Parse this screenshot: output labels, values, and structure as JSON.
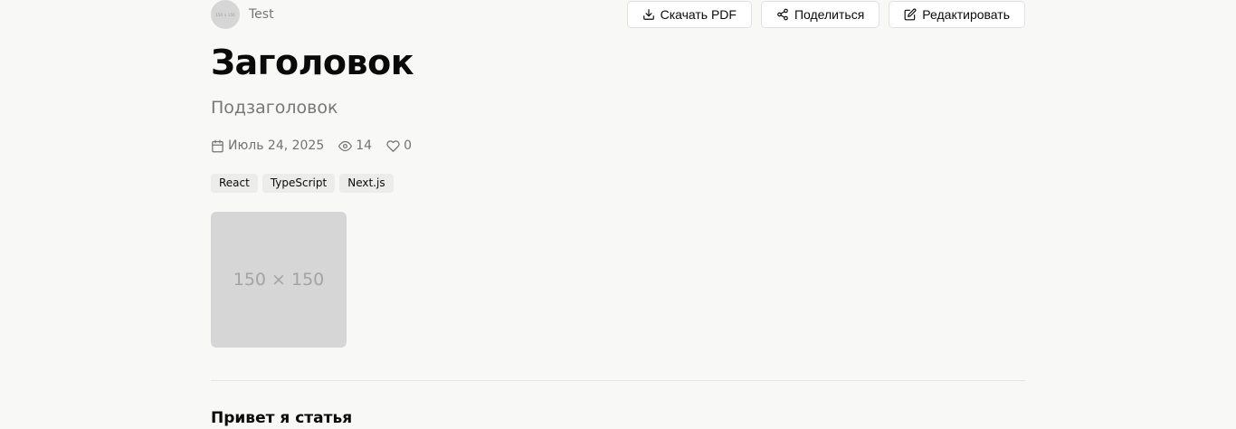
{
  "author": {
    "avatar_text": "150 × 150",
    "name": "Test"
  },
  "actions": {
    "download_label": "Скачать PDF",
    "share_label": "Поделиться",
    "edit_label": "Редактировать"
  },
  "article": {
    "title": "Заголовок",
    "subtitle": "Подзаголовок",
    "date": "Июль 24, 2025",
    "views": "14",
    "likes": "0",
    "tags": [
      "React",
      "TypeScript",
      "Next.js"
    ],
    "image_placeholder": "150 × 150",
    "content_heading": "Привет я статья"
  },
  "icons": {
    "download": "download-icon",
    "share": "share-icon",
    "edit": "edit-icon",
    "calendar": "calendar-icon",
    "views": "eye-icon",
    "likes": "heart-icon"
  }
}
